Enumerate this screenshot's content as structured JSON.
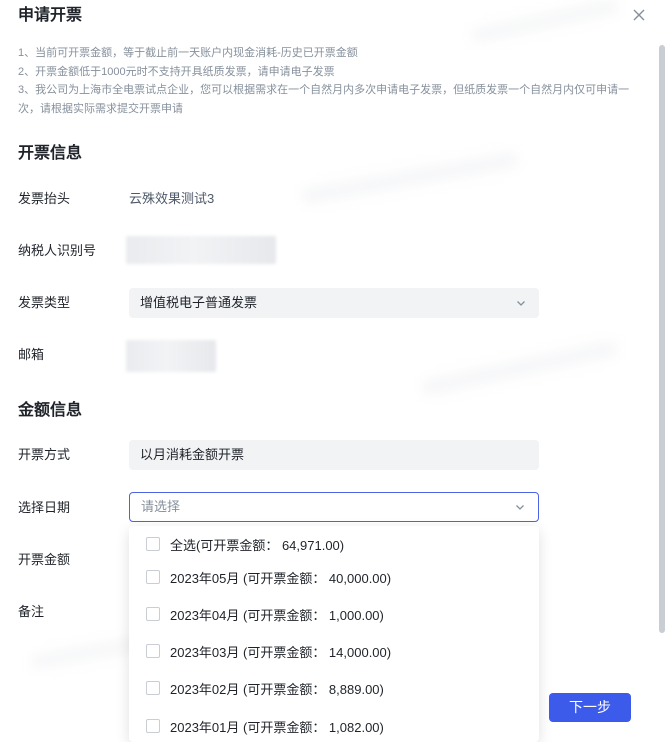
{
  "modal": {
    "title": "申请开票"
  },
  "notes": [
    "1、当前可开票金额，等于截止前一天账户内现金消耗-历史已开票金额",
    "2、开票金额低于1000元时不支持开具纸质发票，请申请电子发票",
    "3、我公司为上海市全电票试点企业，您可以根据需求在一个自然月内多次申请电子发票，但纸质发票一个自然月内仅可申请一次，请根据实际需求提交开票申请"
  ],
  "invoice_info": {
    "section_title": "开票信息",
    "title_label": "发票抬头",
    "title_value": "云殊效果测试3",
    "tax_id_label": "纳税人识别号",
    "type_label": "发票类型",
    "type_value": "增值税电子普通发票",
    "email_label": "邮箱"
  },
  "amount_info": {
    "section_title": "金额信息",
    "method_label": "开票方式",
    "method_value": "以月消耗金额开票",
    "date_label": "选择日期",
    "date_placeholder": "请选择",
    "amount_label": "开票金额",
    "remark_label": "备注"
  },
  "date_options": [
    "全选(可开票金额： 64,971.00)",
    "2023年05月 (可开票金额： 40,000.00)",
    "2023年04月 (可开票金额： 1,000.00)",
    "2023年03月 (可开票金额： 14,000.00)",
    "2023年02月 (可开票金额： 8,889.00)",
    "2023年01月 (可开票金额： 1,082.00)"
  ],
  "footer": {
    "next_label": "下一步"
  },
  "icons": {
    "close": "close-icon",
    "chevron": "chevron-down-icon",
    "checkbox": "checkbox-icon"
  },
  "colors": {
    "primary": "#3c5bea",
    "focus_border": "#4c63e6",
    "muted_text": "#86909c",
    "field_bg": "#f2f3f5"
  }
}
